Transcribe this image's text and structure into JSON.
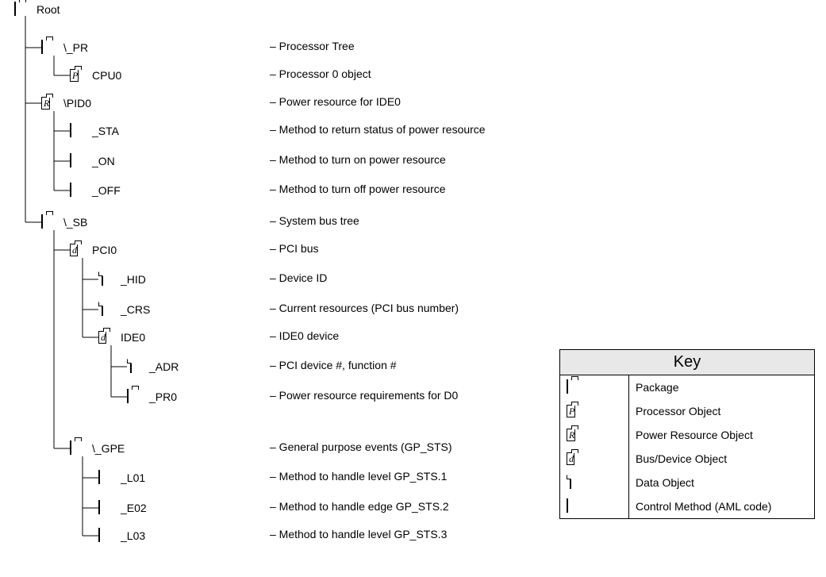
{
  "tree": {
    "root": {
      "label": "Root",
      "desc": ""
    },
    "pr": {
      "label": "\\_PR",
      "desc": "– Processor Tree"
    },
    "cpu0": {
      "label": "CPU0",
      "desc": "– Processor 0 object"
    },
    "pid0": {
      "label": "\\PID0",
      "desc": "– Power resource for IDE0"
    },
    "sta": {
      "label": "_STA",
      "desc": "– Method to return status of power resource"
    },
    "on": {
      "label": "_ON",
      "desc": "– Method to turn on power resource"
    },
    "off": {
      "label": "_OFF",
      "desc": "– Method to turn off power resource"
    },
    "sb": {
      "label": "\\_SB",
      "desc": "– System bus tree"
    },
    "pci0": {
      "label": "PCI0",
      "desc": "– PCI bus"
    },
    "hid": {
      "label": "_HID",
      "desc": "– Device ID"
    },
    "crs": {
      "label": "_CRS",
      "desc": "– Current resources (PCI bus number)"
    },
    "ide0": {
      "label": "IDE0",
      "desc": "– IDE0 device"
    },
    "adr": {
      "label": "_ADR",
      "desc": "– PCI device #, function #"
    },
    "pr0": {
      "label": "_PR0",
      "desc": "– Power resource requirements for D0"
    },
    "gpe": {
      "label": "\\_GPE",
      "desc": "– General purpose events (GP_STS)"
    },
    "l01": {
      "label": "_L01",
      "desc": "– Method to handle level GP_STS.1"
    },
    "e02": {
      "label": "_E02",
      "desc": "– Method to handle edge GP_STS.2"
    },
    "l03": {
      "label": "_L03",
      "desc": "– Method to handle level GP_STS.3"
    }
  },
  "key": {
    "title": "Key",
    "rows": [
      {
        "icon": "pkg",
        "label": "Package"
      },
      {
        "icon": "proc",
        "label": "Processor Object"
      },
      {
        "icon": "pres",
        "label": "Power Resource Object"
      },
      {
        "icon": "dev",
        "label": "Bus/Device Object"
      },
      {
        "icon": "paper",
        "label": "Data Object"
      },
      {
        "icon": "method",
        "label": "Control Method (AML code)"
      }
    ]
  },
  "iconLetters": {
    "proc": "P",
    "pres": "R",
    "dev": "d"
  }
}
